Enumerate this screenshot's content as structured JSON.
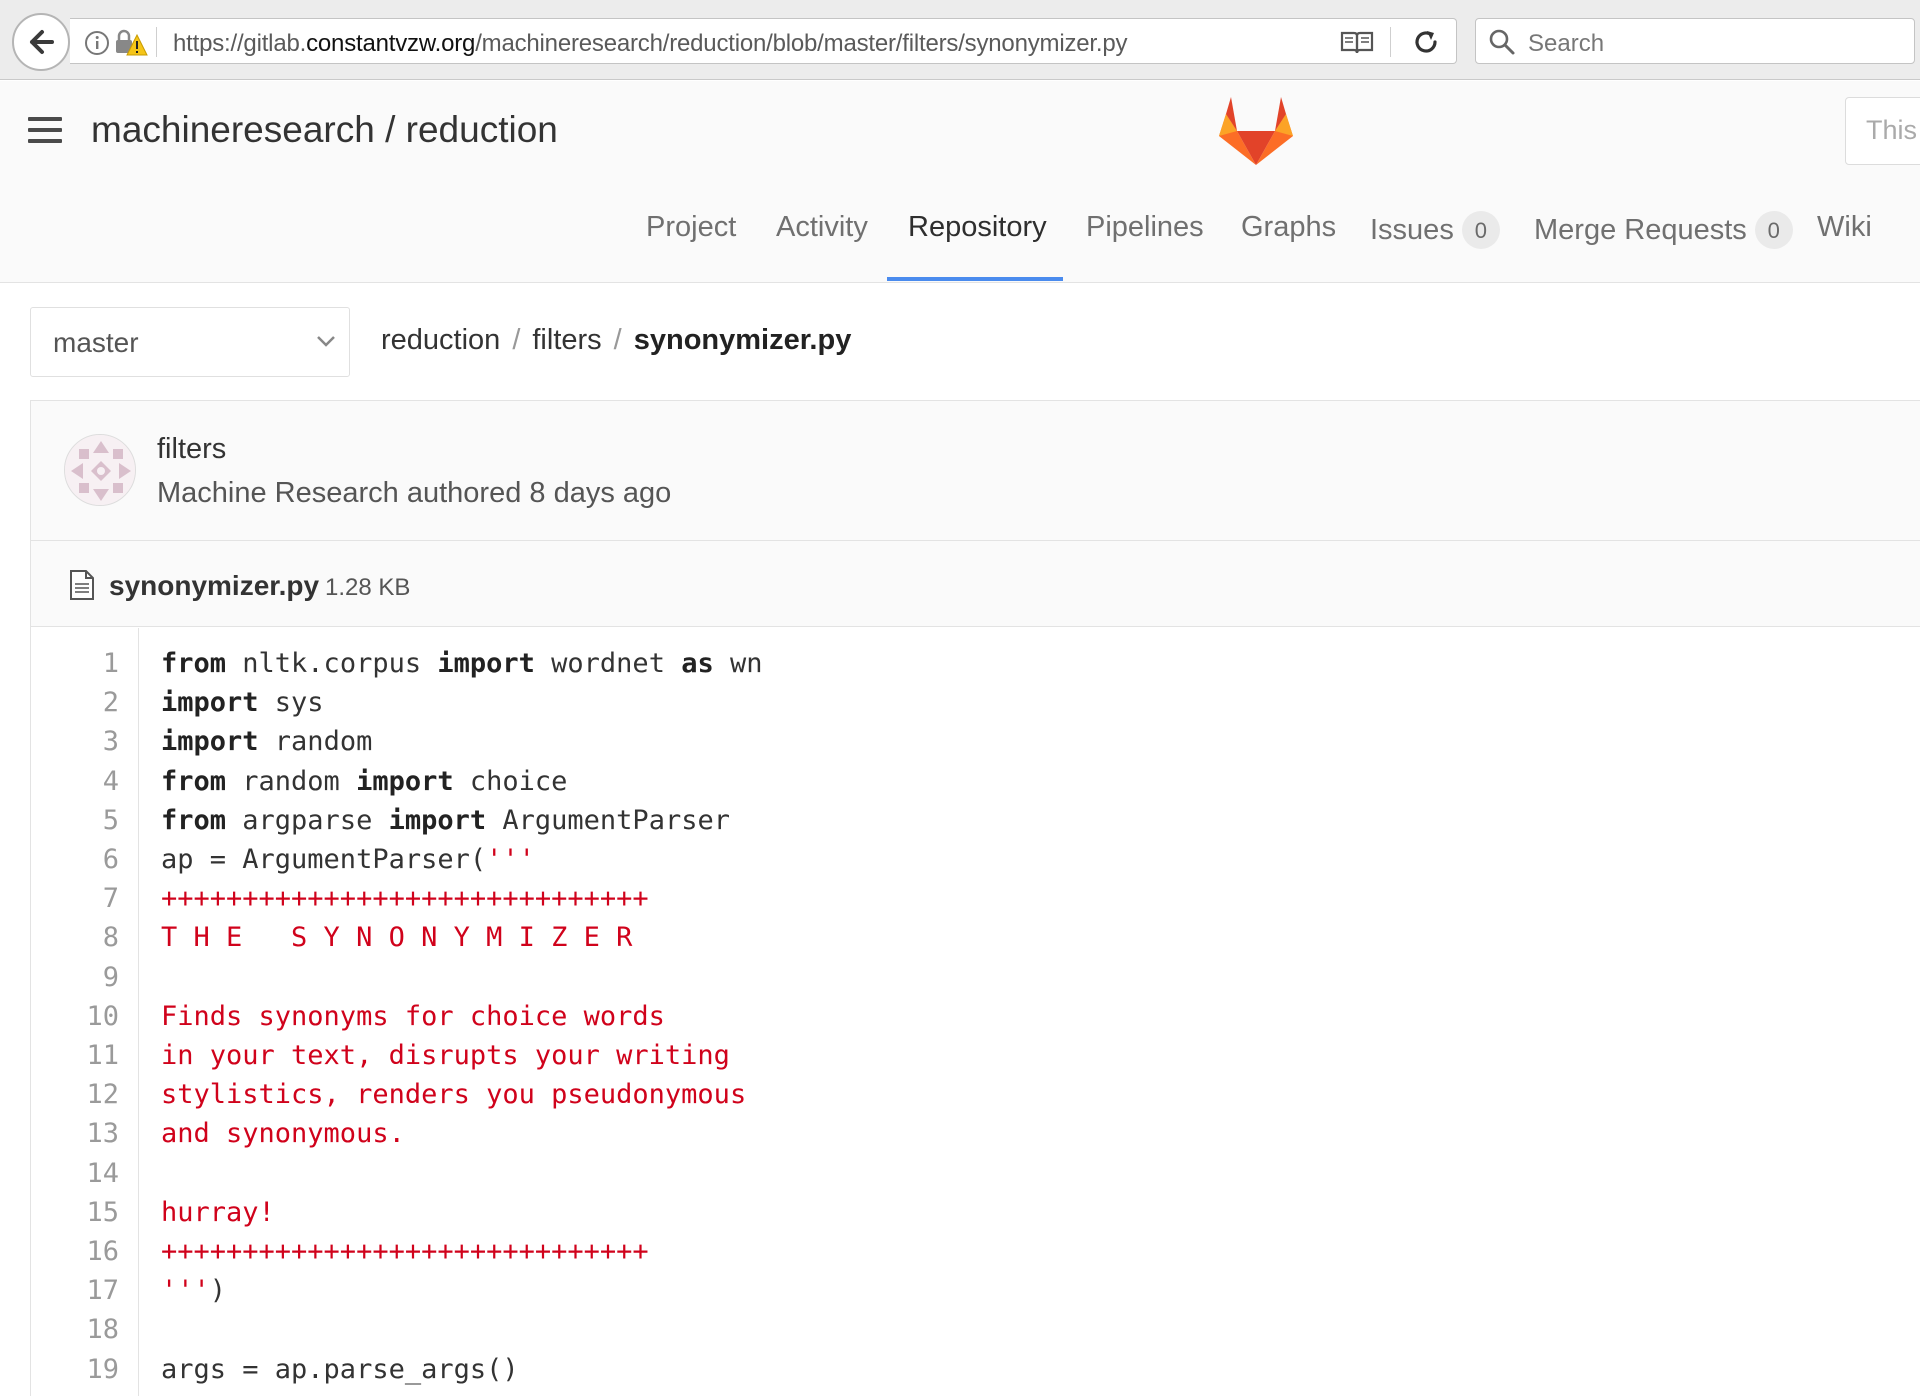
{
  "browser": {
    "url_prefix": "https://gitlab.",
    "url_domain": "constantvzw.org",
    "url_path": "/machineresearch/reduction/blob/master/filters/synonymizer.py",
    "search_placeholder": "Search"
  },
  "header": {
    "project_title": "machineresearch / reduction",
    "search_placeholder": "This"
  },
  "nav": [
    {
      "label": "Project"
    },
    {
      "label": "Activity"
    },
    {
      "label": "Repository",
      "active": true
    },
    {
      "label": "Pipelines"
    },
    {
      "label": "Graphs"
    },
    {
      "label": "Issues",
      "badge": "0"
    },
    {
      "label": "Merge Requests",
      "badge": "0"
    },
    {
      "label": "Wiki"
    }
  ],
  "branch": {
    "selected": "master"
  },
  "breadcrumb": [
    "reduction",
    "filters",
    "synonymizer.py"
  ],
  "commit": {
    "title": "filters",
    "meta": "Machine Research authored 8 days ago"
  },
  "file": {
    "name": "synonymizer.py",
    "size": "1.28 KB"
  },
  "code_lines": [
    {
      "n": "1",
      "tokens": [
        [
          "kw",
          "from"
        ],
        [
          "",
          "nltk.corpus"
        ],
        [
          "kw",
          "import"
        ],
        [
          "",
          "wordnet"
        ],
        [
          "kw",
          "as"
        ],
        [
          "",
          "wn"
        ]
      ]
    },
    {
      "n": "2",
      "tokens": [
        [
          "kw",
          "import"
        ],
        [
          "",
          "sys"
        ]
      ]
    },
    {
      "n": "3",
      "tokens": [
        [
          "kw",
          "import"
        ],
        [
          "",
          "random"
        ]
      ]
    },
    {
      "n": "4",
      "tokens": [
        [
          "kw",
          "from"
        ],
        [
          "",
          "random"
        ],
        [
          "kw",
          "import"
        ],
        [
          "",
          "choice"
        ]
      ]
    },
    {
      "n": "5",
      "tokens": [
        [
          "kw",
          "from"
        ],
        [
          "",
          "argparse"
        ],
        [
          "kw",
          "import"
        ],
        [
          "",
          "ArgumentParser"
        ]
      ]
    },
    {
      "n": "6",
      "tokens": [
        [
          "",
          "ap = ArgumentParser("
        ],
        [
          "str",
          "'''"
        ]
      ]
    },
    {
      "n": "7",
      "tokens": [
        [
          "str",
          "++++++++++++++++++++++++++++++"
        ]
      ]
    },
    {
      "n": "8",
      "tokens": [
        [
          "str",
          "T H E   S Y N O N Y M I Z E R"
        ]
      ]
    },
    {
      "n": "9",
      "tokens": []
    },
    {
      "n": "10",
      "tokens": [
        [
          "str",
          "Finds synonyms for choice words"
        ]
      ]
    },
    {
      "n": "11",
      "tokens": [
        [
          "str",
          "in your text, disrupts your writing"
        ]
      ]
    },
    {
      "n": "12",
      "tokens": [
        [
          "str",
          "stylistics, renders you pseudonymous"
        ]
      ]
    },
    {
      "n": "13",
      "tokens": [
        [
          "str",
          "and synonymous."
        ]
      ]
    },
    {
      "n": "14",
      "tokens": []
    },
    {
      "n": "15",
      "tokens": [
        [
          "str",
          "hurray!"
        ]
      ]
    },
    {
      "n": "16",
      "tokens": [
        [
          "str",
          "++++++++++++++++++++++++++++++"
        ]
      ]
    },
    {
      "n": "17",
      "tokens": [
        [
          "str",
          "'''"
        ],
        [
          "",
          ")"
        ]
      ]
    },
    {
      "n": "18",
      "tokens": []
    },
    {
      "n": "19",
      "tokens": [
        [
          "",
          "args = ap.parse_args()"
        ]
      ]
    }
  ]
}
